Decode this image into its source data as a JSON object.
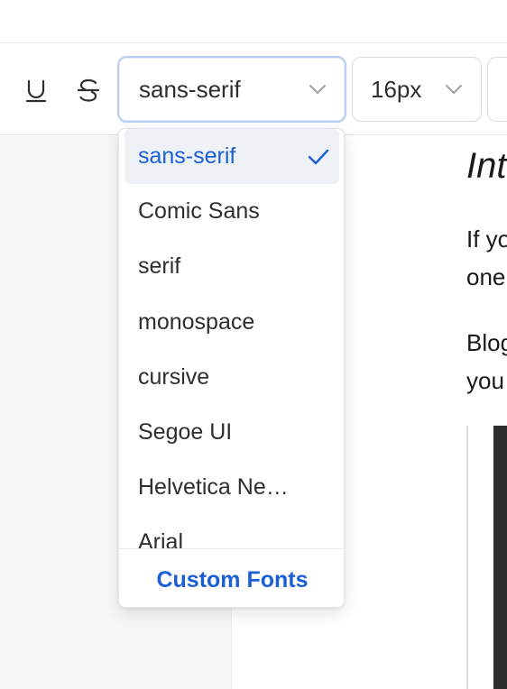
{
  "toolbar": {
    "font_select": {
      "value": "sans-serif"
    },
    "size_select": {
      "value": "16px"
    }
  },
  "editor": {
    "heading": "Int",
    "paragraph1_line1": "If yo",
    "paragraph1_line2": "one",
    "paragraph2_line1": "Blog",
    "paragraph2_line2": "you"
  },
  "font_dropdown": {
    "options": [
      {
        "label": "sans-serif",
        "selected": true
      },
      {
        "label": "Comic Sans"
      },
      {
        "label": "serif"
      },
      {
        "label": "monospace"
      },
      {
        "label": "cursive"
      },
      {
        "label": "Segoe UI"
      },
      {
        "label": "Helvetica Ne…"
      },
      {
        "label": "Arial"
      }
    ],
    "footer_label": "Custom Fonts"
  },
  "colors": {
    "accent": "#1a5fd6",
    "selected_bg": "#eef1f6",
    "sidebar_bg": "#f6f7f9"
  },
  "icons": [
    "underline-icon",
    "strikethrough-icon",
    "chevron-down-icon",
    "check-icon"
  ]
}
